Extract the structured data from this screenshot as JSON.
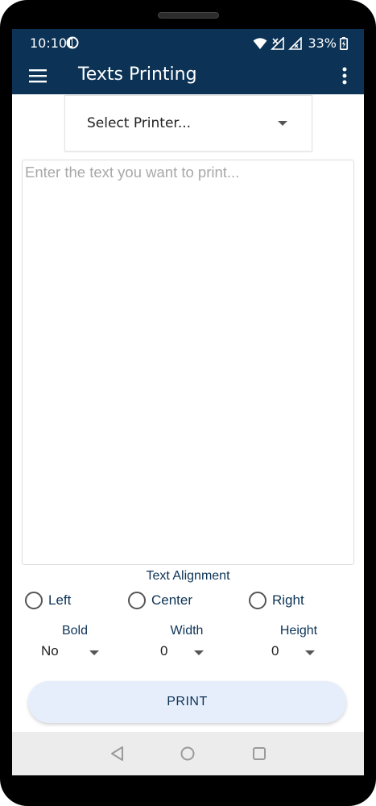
{
  "status_bar": {
    "time": "10:10",
    "battery": "33%",
    "icons": [
      "app-notification-icon",
      "wifi-icon",
      "signal-off-icon",
      "signal-icon",
      "battery-icon"
    ]
  },
  "app_bar": {
    "title": "Texts Printing",
    "icons": [
      "menu-icon",
      "more-vert-icon"
    ],
    "color": "#0c3356"
  },
  "printer_select": {
    "label": "Select Printer..."
  },
  "text_input": {
    "value": "",
    "placeholder": "Enter the text you want to print..."
  },
  "alignment": {
    "title": "Text Alignment",
    "options": [
      {
        "label": "Left",
        "selected": false
      },
      {
        "label": "Center",
        "selected": false
      },
      {
        "label": "Right",
        "selected": false
      }
    ]
  },
  "options": {
    "bold": {
      "title": "Bold",
      "value": "No"
    },
    "width": {
      "title": "Width",
      "value": "0"
    },
    "height": {
      "title": "Height",
      "value": "0"
    }
  },
  "print_button": {
    "label": "PRINT",
    "background": "#e6eefc"
  },
  "nav_bar": {
    "icons": [
      "back-icon",
      "home-icon",
      "recents-icon"
    ]
  }
}
